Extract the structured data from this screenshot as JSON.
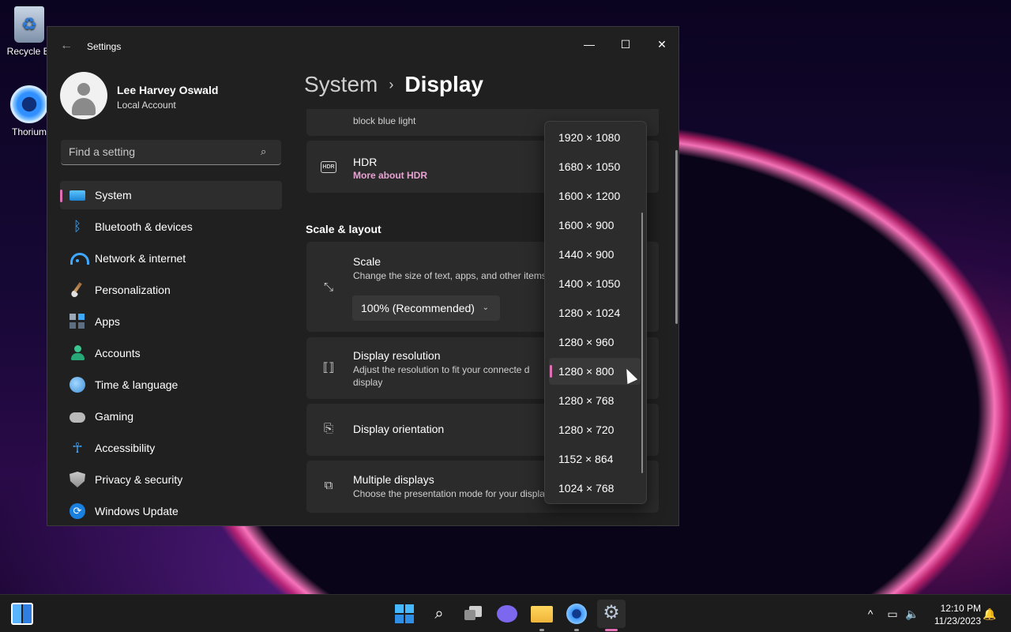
{
  "desktop": {
    "icons": [
      {
        "label": "Recycle Bi"
      },
      {
        "label": "Thorium"
      }
    ]
  },
  "window": {
    "title": "Settings",
    "controls": {
      "minimize": "—",
      "maximize": "☐",
      "close": "✕"
    }
  },
  "profile": {
    "name": "Lee Harvey Oswald",
    "account_type": "Local Account"
  },
  "search": {
    "placeholder": "Find a setting"
  },
  "sidebar": {
    "items": [
      {
        "label": "System",
        "icon": "system-icon",
        "active": true
      },
      {
        "label": "Bluetooth & devices",
        "icon": "bluetooth-icon"
      },
      {
        "label": "Network & internet",
        "icon": "wifi-icon"
      },
      {
        "label": "Personalization",
        "icon": "brush-icon"
      },
      {
        "label": "Apps",
        "icon": "apps-icon"
      },
      {
        "label": "Accounts",
        "icon": "accounts-icon"
      },
      {
        "label": "Time & language",
        "icon": "globe-clock-icon"
      },
      {
        "label": "Gaming",
        "icon": "gamepad-icon"
      },
      {
        "label": "Accessibility",
        "icon": "accessibility-icon"
      },
      {
        "label": "Privacy & security",
        "icon": "shield-icon"
      },
      {
        "label": "Windows Update",
        "icon": "update-icon"
      }
    ]
  },
  "breadcrumb": {
    "parent": "System",
    "separator": "›",
    "current": "Display"
  },
  "main": {
    "night_light": {
      "desc": "block blue light"
    },
    "hdr": {
      "title": "HDR",
      "link": "More about HDR",
      "icon_label": "HDR"
    },
    "section_scale_layout": "Scale & layout",
    "scale": {
      "title": "Scale",
      "desc": "Change the size of text, apps, and other items",
      "value": "100% (Recommended)"
    },
    "resolution": {
      "title": "Display resolution",
      "desc": "Adjust the resolution to fit your connecte d display"
    },
    "orientation": {
      "title": "Display orientation"
    },
    "multiple": {
      "title": "Multiple displays",
      "desc": "Choose the presentation mode for your displa"
    }
  },
  "resolution_dropdown": {
    "options": [
      "1920 × 1080",
      "1680 × 1050",
      "1600 × 1200",
      "1600 × 900",
      "1440 × 900",
      "1400 × 1050",
      "1280 × 1024",
      "1280 × 960",
      "1280 × 800",
      "1280 × 768",
      "1280 × 720",
      "1152 × 864",
      "1024 × 768"
    ],
    "selected": "1280 × 800"
  },
  "taskbar": {
    "clock_time": "12:10 PM",
    "clock_date": "11/23/2023",
    "tray_chevron": "^"
  },
  "colors": {
    "accent": "#e06fb6",
    "link": "#e8a3d3",
    "window_bg": "#202020",
    "card_bg": "#2b2b2b"
  }
}
